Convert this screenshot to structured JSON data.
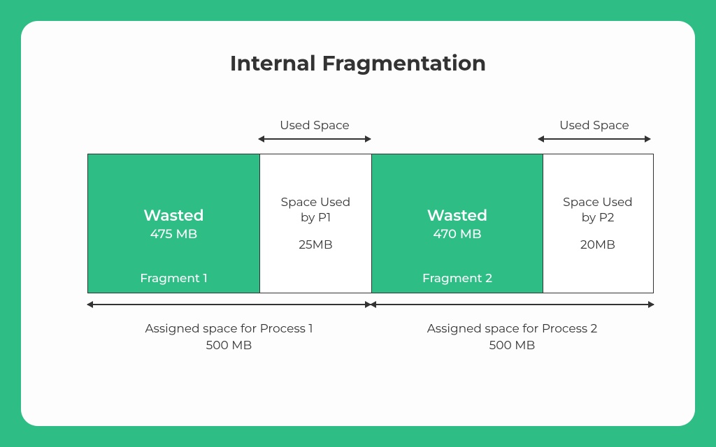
{
  "title": "Internal Fragmentation",
  "fragments": [
    {
      "used_label": "Used Space",
      "wasted_title": "Wasted",
      "wasted_size": "475 MB",
      "fragment_name": "Fragment 1",
      "used_by_line1": "Space Used",
      "used_by_line2": "by P1",
      "used_size": "25MB",
      "assigned_label": "Assigned space for Process 1",
      "assigned_size": "500 MB"
    },
    {
      "used_label": "Used Space",
      "wasted_title": "Wasted",
      "wasted_size": "470 MB",
      "fragment_name": "Fragment 2",
      "used_by_line1": "Space Used",
      "used_by_line2": "by P2",
      "used_size": "20MB",
      "assigned_label": "Assigned space for Process 2",
      "assigned_size": "500 MB"
    }
  ],
  "chart_data": {
    "type": "bar",
    "title": "Internal Fragmentation",
    "unit": "MB",
    "processes": [
      {
        "name": "Process 1",
        "assigned_mb": 500,
        "used_mb": 25,
        "wasted_mb": 475
      },
      {
        "name": "Process 2",
        "assigned_mb": 500,
        "used_mb": 20,
        "wasted_mb": 470
      }
    ]
  }
}
